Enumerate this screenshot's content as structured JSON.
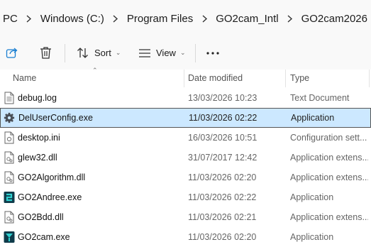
{
  "breadcrumb": {
    "items": [
      "PC",
      "Windows (C:)",
      "Program Files",
      "GO2cam_Intl",
      "GO2cam2026"
    ]
  },
  "toolbar": {
    "share_icon": "share-icon",
    "delete_icon": "trash-icon",
    "sort_label": "Sort",
    "view_label": "View",
    "more_icon": "more-icon"
  },
  "columns": {
    "name": "Name",
    "date": "Date modified",
    "type": "Type"
  },
  "files": [
    {
      "name": "debug.log",
      "date": "13/03/2026 10:23",
      "type": "Text Document",
      "icon": "text-file-icon",
      "selected": false
    },
    {
      "name": "DelUserConfig.exe",
      "date": "11/03/2026 02:22",
      "type": "Application",
      "icon": "gear-app-icon",
      "selected": true
    },
    {
      "name": "desktop.ini",
      "date": "16/03/2026 10:51",
      "type": "Configuration sett...",
      "icon": "config-file-icon",
      "selected": false
    },
    {
      "name": "glew32.dll",
      "date": "31/07/2017 12:42",
      "type": "Application extens...",
      "icon": "dll-file-icon",
      "selected": false
    },
    {
      "name": "GO2Algorithm.dll",
      "date": "11/03/2026 02:20",
      "type": "Application extens...",
      "icon": "dll-file-icon",
      "selected": false
    },
    {
      "name": "GO2Andree.exe",
      "date": "11/03/2026 02:22",
      "type": "Application",
      "icon": "go2andree-app-icon",
      "selected": false
    },
    {
      "name": "GO2Bdd.dll",
      "date": "11/03/2026 02:21",
      "type": "Application extens...",
      "icon": "dll-file-icon",
      "selected": false
    },
    {
      "name": "GO2cam.exe",
      "date": "11/03/2026 02:20",
      "type": "Application",
      "icon": "go2cam-app-icon",
      "selected": false
    }
  ],
  "colors": {
    "selection": "#cce8ff",
    "toolbar_bg": "#f9f9f9",
    "accent": "#1a7fd1",
    "teal": "#1aa6a6"
  }
}
